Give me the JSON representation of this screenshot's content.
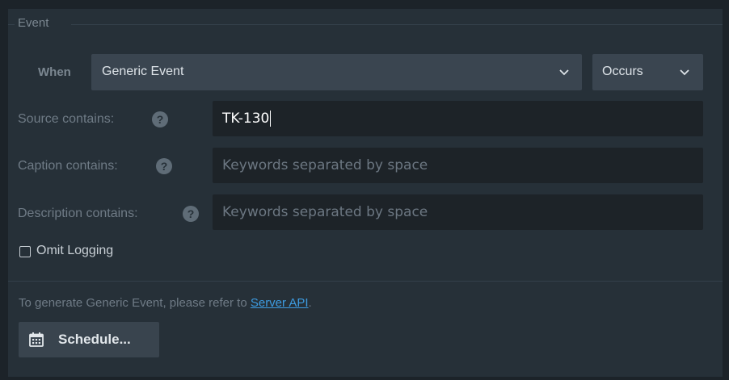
{
  "fieldset": {
    "legend": "Event"
  },
  "when": {
    "label": "When",
    "event_type": {
      "selected": "Generic Event",
      "icon": "chevron-down-icon"
    },
    "occurrence": {
      "selected": "Occurs",
      "icon": "chevron-down-icon"
    }
  },
  "fields": {
    "source": {
      "label": "Source contains:",
      "value": "TK-130",
      "placeholder": "",
      "help_icon": "question-icon"
    },
    "caption": {
      "label": "Caption contains:",
      "value": "",
      "placeholder": "Keywords separated by space",
      "help_icon": "question-icon"
    },
    "description": {
      "label": "Description contains:",
      "value": "",
      "placeholder": "Keywords separated by space",
      "help_icon": "question-icon"
    }
  },
  "omit_logging": {
    "label": "Omit Logging",
    "checked": false
  },
  "info": {
    "prefix": "To generate Generic Event, please refer to ",
    "link_text": "Server API",
    "suffix": "."
  },
  "schedule_button": {
    "label": "Schedule...",
    "icon": "calendar-icon"
  },
  "colors": {
    "background": "#263038",
    "input_background": "#1d2328",
    "select_background": "#3a4550",
    "link": "#3d9be0"
  }
}
